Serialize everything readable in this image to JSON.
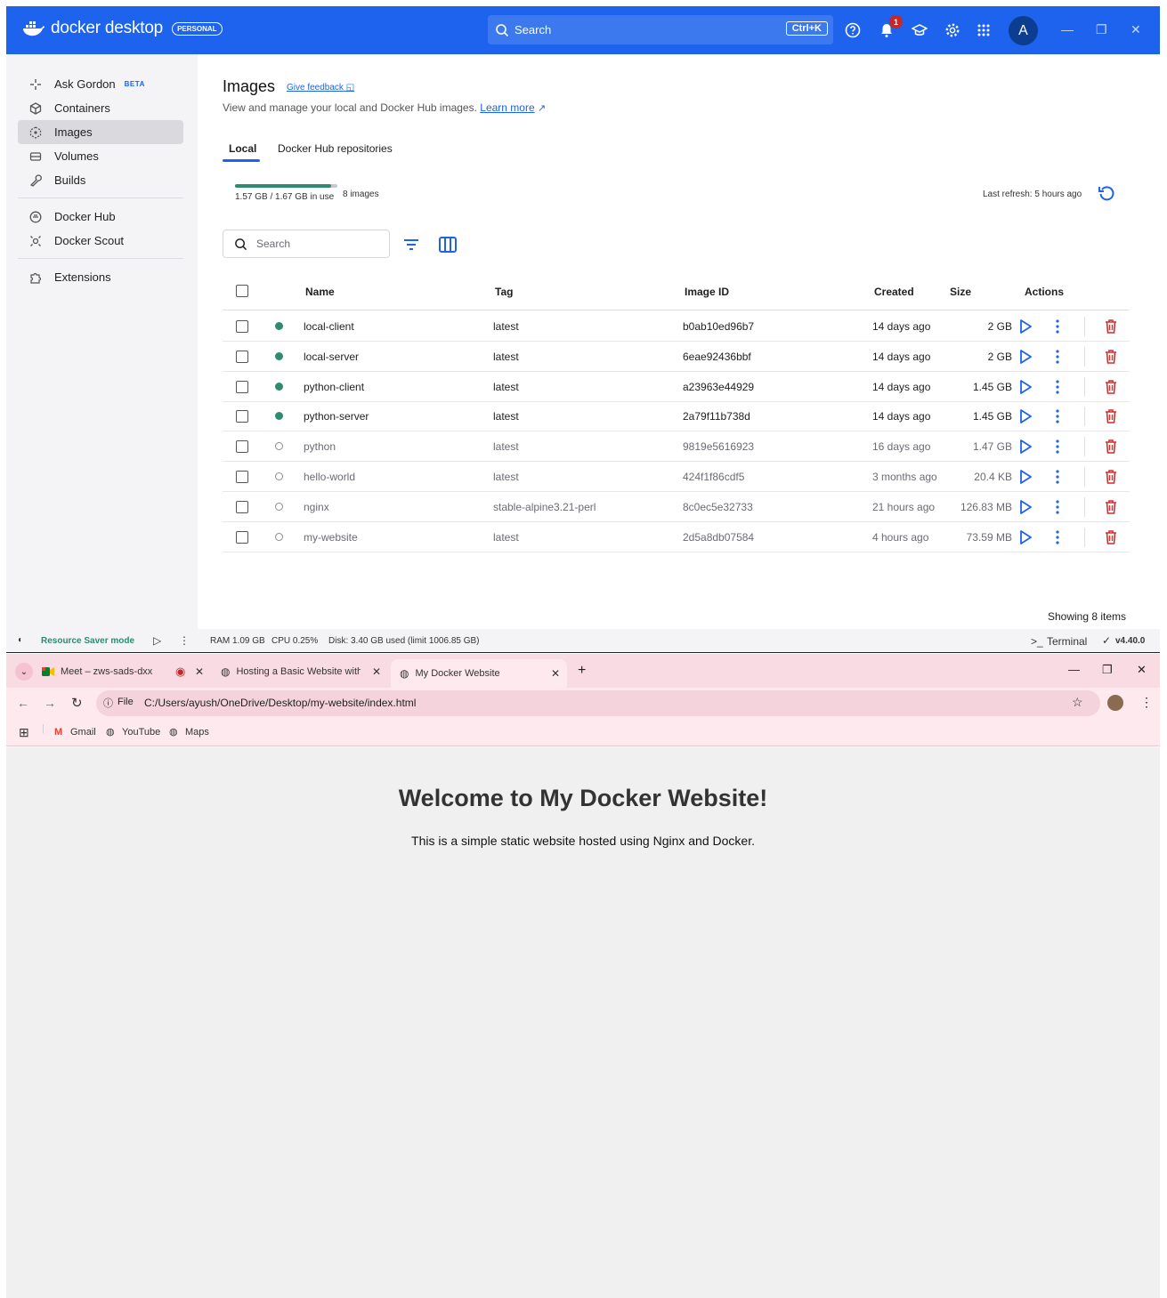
{
  "docker": {
    "brand": "docker desktop",
    "plan_badge": "PERSONAL",
    "search_label": "Search",
    "search_shortcut": "Ctrl+K",
    "notification_count": "1",
    "avatar_letter": "A",
    "accent_color": "#1d63ed",
    "sidebar": {
      "items": [
        {
          "label": "Ask Gordon",
          "badge": "BETA",
          "icon": "gordon-icon"
        },
        {
          "label": "Containers",
          "icon": "containers-icon"
        },
        {
          "label": "Images",
          "icon": "images-icon",
          "active": true
        },
        {
          "label": "Volumes",
          "icon": "volumes-icon"
        },
        {
          "label": "Builds",
          "icon": "builds-icon"
        },
        {
          "label": "Docker Hub",
          "icon": "docker-hub-icon"
        },
        {
          "label": "Docker Scout",
          "icon": "docker-scout-icon"
        },
        {
          "label": "Extensions",
          "icon": "extensions-icon"
        }
      ]
    },
    "main": {
      "title": "Images",
      "give_feedback": "Give feedback",
      "subtitle": "View and manage your local and Docker Hub images.",
      "learn_more": "Learn more",
      "tabs": [
        {
          "label": "Local",
          "active": true
        },
        {
          "label": "Docker Hub repositories"
        }
      ],
      "usage_text": "1.57 GB / 1.67 GB in use",
      "usage_fraction": 0.94,
      "image_count": "8 images",
      "last_refresh": "Last refresh: 5 hours ago",
      "search_placeholder": "Search",
      "columns": [
        "Name",
        "Tag",
        "Image ID",
        "Created",
        "Size",
        "Actions"
      ],
      "rows": [
        {
          "name": "local-client",
          "tag": "latest",
          "image_id": "b0ab10ed96b7",
          "created": "14 days ago",
          "size": "2 GB",
          "in_use": true
        },
        {
          "name": "local-server",
          "tag": "latest",
          "image_id": "6eae92436bbf",
          "created": "14 days ago",
          "size": "2 GB",
          "in_use": true
        },
        {
          "name": "python-client",
          "tag": "latest",
          "image_id": "a23963e44929",
          "created": "14 days ago",
          "size": "1.45 GB",
          "in_use": true
        },
        {
          "name": "python-server",
          "tag": "latest",
          "image_id": "2a79f11b738d",
          "created": "14 days ago",
          "size": "1.45 GB",
          "in_use": true
        },
        {
          "name": "python",
          "tag": "latest",
          "image_id": "9819e5616923",
          "created": "16 days ago",
          "size": "1.47 GB",
          "in_use": false
        },
        {
          "name": "hello-world",
          "tag": "latest",
          "image_id": "424f1f86cdf5",
          "created": "3 months ago",
          "size": "20.4 KB",
          "in_use": false
        },
        {
          "name": "nginx",
          "tag": "stable-alpine3.21-perl",
          "image_id": "8c0ec5e32733",
          "created": "21 hours ago",
          "size": "126.83 MB",
          "in_use": false
        },
        {
          "name": "my-website",
          "tag": "latest",
          "image_id": "2d5a8db07584",
          "created": "4 hours ago",
          "size": "73.59 MB",
          "in_use": false
        }
      ],
      "showing": "Showing 8 items"
    },
    "footer": {
      "resource_saver": "Resource Saver mode",
      "ram": "RAM 1.09 GB",
      "cpu": "CPU 0.25%",
      "disk": "Disk: 3.40 GB used (limit 1006.85 GB)",
      "terminal": "Terminal",
      "version": "v4.40.0"
    }
  },
  "browser": {
    "tabs": [
      {
        "label": "Meet – zws-sads-dxx",
        "icon": "google-meet-icon"
      },
      {
        "label": "Hosting a Basic Website with D",
        "icon": "globe-icon"
      },
      {
        "label": "My Docker Website",
        "icon": "globe-icon",
        "active": true
      }
    ],
    "omnibox_scheme": "File",
    "url": "C:/Users/ayush/OneDrive/Desktop/my-website/index.html",
    "bookmarks": [
      "Gmail",
      "YouTube",
      "Maps"
    ],
    "page": {
      "heading": "Welcome to My Docker Website!",
      "paragraph": "This is a simple static website hosted using Nginx and Docker."
    }
  }
}
